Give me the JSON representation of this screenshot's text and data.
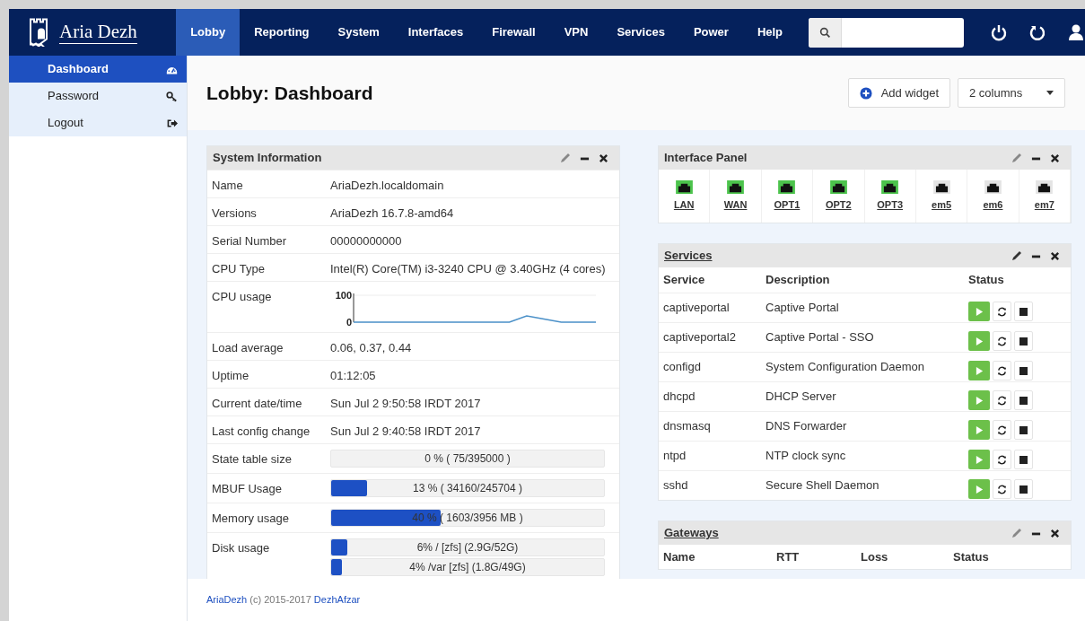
{
  "brand": {
    "name": "Aria Dezh"
  },
  "nav": [
    {
      "label": "Lobby",
      "selected": true
    },
    {
      "label": "Reporting",
      "selected": false
    },
    {
      "label": "System",
      "selected": false
    },
    {
      "label": "Interfaces",
      "selected": false
    },
    {
      "label": "Firewall",
      "selected": false
    },
    {
      "label": "VPN",
      "selected": false
    },
    {
      "label": "Services",
      "selected": false
    },
    {
      "label": "Power",
      "selected": false
    },
    {
      "label": "Help",
      "selected": false
    }
  ],
  "sidebar": {
    "items": [
      {
        "label": "Dashboard",
        "selected": true
      },
      {
        "label": "Password",
        "selected": false
      },
      {
        "label": "Logout",
        "selected": false
      }
    ]
  },
  "page_title": "Lobby: Dashboard",
  "toolbar": {
    "add_widget": "Add widget",
    "columns": "2 columns"
  },
  "system_information": {
    "title": "System Information",
    "rows": [
      {
        "kind": "text",
        "label": "Name",
        "value": "AriaDezh.localdomain"
      },
      {
        "kind": "text",
        "label": "Versions",
        "value": "AriaDezh 16.7.8-amd64"
      },
      {
        "kind": "text",
        "label": "Serial Number",
        "value": "00000000000"
      },
      {
        "kind": "text",
        "label": "CPU Type",
        "value": "Intel(R) Core(TM) i3-3240 CPU @ 3.40GHz (4 cores)"
      },
      {
        "kind": "chart",
        "label": "CPU usage",
        "chart_data": {
          "type": "line",
          "ylim": [
            0,
            100
          ],
          "yticks": [
            0,
            100
          ],
          "series": [
            {
              "color": "#4a90c8",
              "values": [
                0,
                0,
                0,
                0,
                0,
                0,
                0,
                0,
                0,
                0,
                23,
                12,
                0,
                0,
                0
              ]
            }
          ]
        }
      },
      {
        "kind": "text",
        "label": "Load average",
        "value": "0.06, 0.37, 0.44"
      },
      {
        "kind": "text",
        "label": "Uptime",
        "value": "01:12:05"
      },
      {
        "kind": "text",
        "label": "Current date/time",
        "value": "Sun Jul 2 9:50:58 IRDT 2017"
      },
      {
        "kind": "text",
        "label": "Last config change",
        "value": "Sun Jul 2 9:40:58 IRDT 2017"
      },
      {
        "kind": "bars",
        "label": "State table size",
        "bars": [
          {
            "level": 0,
            "reading": "0 % ( 75/395000 )"
          }
        ]
      },
      {
        "kind": "bars",
        "label": "MBUF Usage",
        "bars": [
          {
            "level": 0.13,
            "reading": "13 % ( 34160/245704 )"
          }
        ]
      },
      {
        "kind": "bars",
        "label": "Memory usage",
        "bars": [
          {
            "level": 0.4,
            "reading": "40 % ( 1603/3956 MB )"
          }
        ]
      },
      {
        "kind": "bars",
        "label": "Disk usage",
        "bars": [
          {
            "level": 0.06,
            "reading": "6% / [zfs] (2.9G/52G)"
          },
          {
            "level": 0.04,
            "reading": "4% /var [zfs] (1.8G/49G)"
          }
        ]
      }
    ]
  },
  "interface_panel": {
    "title": "Interface Panel",
    "interfaces": [
      {
        "name": "LAN",
        "connected": true
      },
      {
        "name": "WAN",
        "connected": true
      },
      {
        "name": "OPT1",
        "connected": true
      },
      {
        "name": "OPT2",
        "connected": true
      },
      {
        "name": "OPT3",
        "connected": true
      },
      {
        "name": "em5",
        "connected": false
      },
      {
        "name": "em6",
        "connected": false
      },
      {
        "name": "em7",
        "connected": false
      }
    ]
  },
  "services": {
    "title": "Services",
    "columns": [
      "Service",
      "Description",
      "Status"
    ],
    "rows": [
      {
        "service": "captiveportal",
        "description": "Captive Portal",
        "running": true
      },
      {
        "service": "captiveportal2",
        "description": "Captive Portal - SSO",
        "running": true
      },
      {
        "service": "configd",
        "description": "System Configuration Daemon",
        "running": true
      },
      {
        "service": "dhcpd",
        "description": "DHCP Server",
        "running": true
      },
      {
        "service": "dnsmasq",
        "description": "DNS Forwarder",
        "running": true
      },
      {
        "service": "ntpd",
        "description": "NTP clock sync",
        "running": true
      },
      {
        "service": "sshd",
        "description": "Secure Shell Daemon",
        "running": true
      }
    ]
  },
  "gateways": {
    "title": "Gateways",
    "columns": [
      "Name",
      "RTT",
      "Loss",
      "Status"
    ]
  },
  "footer": {
    "link_1": "AriaDezh",
    "text": "(c) 2015-2017",
    "link_2": "DezhAfzar"
  }
}
